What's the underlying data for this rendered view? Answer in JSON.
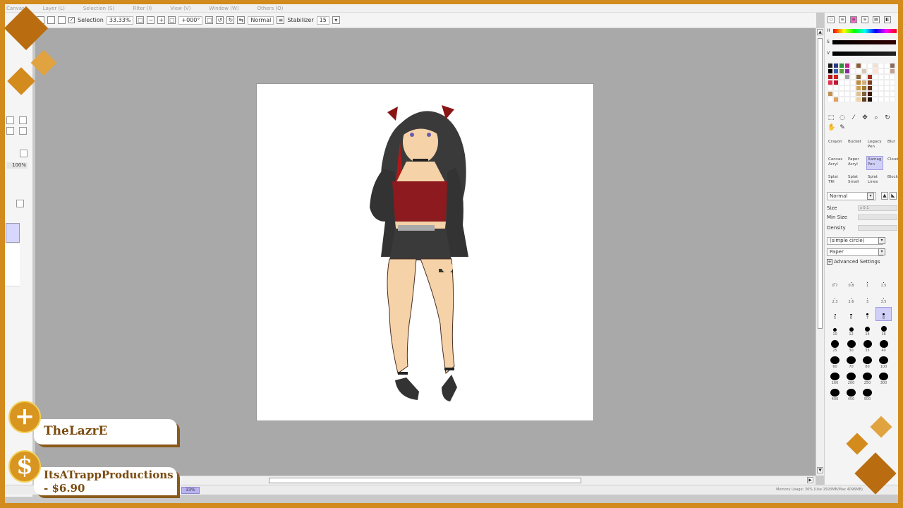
{
  "menu": {
    "items": [
      "Canvas",
      "Layer (L)",
      "Selection (S)",
      "Filter (I)",
      "View (V)",
      "Window (W)",
      "Others (O)"
    ]
  },
  "toolbar": {
    "selection_label": "Selection",
    "zoom_value": "33.33%",
    "rotation_value": "+000°",
    "blend_mode": "Normal",
    "stabilizer_label": "Stabilizer",
    "stabilizer_value": "15"
  },
  "left_panel": {
    "zoom_label": "100%"
  },
  "status": {
    "zoom_badge": "33%",
    "memory_text": "Memory Usage: 36% (Use 1593MB/Max 4096MB)"
  },
  "color_panel": {
    "h_label": "H",
    "s_label": "S",
    "v_label": "V",
    "swatch_colors": [
      "#1a1a1a",
      "#2a3a8a",
      "#2e8f3a",
      "#c0208a",
      "#ffffff",
      "#8a5a3a",
      "#ffffff",
      "#ffffff",
      "#f0e0d0",
      "#ffffff",
      "#ffffff",
      "#8a6a5a",
      "#000000",
      "#3a5aaa",
      "#5aa040",
      "#8a2aa0",
      "#ffffff",
      "#ffffff",
      "#d8c8b8",
      "#ffffff",
      "#ffe0d0",
      "#ffffff",
      "#ffffff",
      "#c0a090",
      "#b01818",
      "#d02020",
      "#ffffff",
      "#a0a0a0",
      "#ffffff",
      "#8a6a3a",
      "#ffffff",
      "#a03020",
      "#ffffff",
      "#ffffff",
      "#ffffff",
      "#ffffff",
      "#e03050",
      "#c01830",
      "#ffffff",
      "#ffffff",
      "#ffffff",
      "#c08a3a",
      "#d0b080",
      "#804020",
      "#ffffff",
      "#ffffff",
      "#ffffff",
      "#ffffff",
      "#ffffff",
      "#ffffff",
      "#ffffff",
      "#ffffff",
      "#ffffff",
      "#d0a050",
      "#a07830",
      "#603018",
      "#ffffff",
      "#ffffff",
      "#ffffff",
      "#ffffff",
      "#c09050",
      "#ffffff",
      "#ffffff",
      "#ffffff",
      "#ffffff",
      "#e0c090",
      "#806040",
      "#401808",
      "#ffffff",
      "#ffffff",
      "#ffffff",
      "#ffffff",
      "#ffffff",
      "#e0a060",
      "#ffffff",
      "#ffffff",
      "#ffffff",
      "#f0d0a0",
      "#604020",
      "#201008",
      "#ffffff",
      "#ffffff",
      "#ffffff",
      "#ffffff"
    ]
  },
  "tools": {
    "icons": [
      "rect-select-icon",
      "lasso-icon",
      "magic-wand-icon",
      "move-icon",
      "zoom-icon",
      "rotate-icon",
      "hand-icon",
      "eyedropper-icon"
    ],
    "glyphs": [
      "⬚",
      "◌",
      "⁄",
      "✥",
      "⌕",
      "↻",
      "✋",
      "✎"
    ]
  },
  "brushes": [
    {
      "name": "Crayon",
      "selected": false
    },
    {
      "name": "Bucket",
      "selected": false
    },
    {
      "name": "Legacy Pen",
      "selected": false
    },
    {
      "name": "Blur",
      "selected": false
    },
    {
      "name": "Canvas Acryl",
      "selected": false
    },
    {
      "name": "Paper Acryl",
      "selected": false
    },
    {
      "name": "Xamag Pen",
      "selected": true
    },
    {
      "name": "Cloud",
      "selected": false
    },
    {
      "name": "Splat TRI",
      "selected": false
    },
    {
      "name": "Splat Small",
      "selected": false
    },
    {
      "name": "Splat Lines",
      "selected": false
    },
    {
      "name": "Block",
      "selected": false
    }
  ],
  "brush_settings": {
    "blend": "Normal",
    "size_label": "Size",
    "size_value": "x 0.1",
    "min_size_label": "Min Size",
    "density_label": "Density",
    "shape": "(simple circle)",
    "texture": "Paper",
    "advanced_label": "Advanced Settings"
  },
  "brush_sizes": [
    {
      "label": "0.7",
      "dot": 0.5,
      "selected": false
    },
    {
      "label": "0.8",
      "dot": 0.6,
      "selected": false
    },
    {
      "label": "1",
      "dot": 0.7,
      "selected": false
    },
    {
      "label": "1.5",
      "dot": 0.8,
      "selected": false
    },
    {
      "label": "2.3",
      "dot": 0.9,
      "selected": false
    },
    {
      "label": "2.6",
      "dot": 1,
      "selected": false
    },
    {
      "label": "3",
      "dot": 1.1,
      "selected": false
    },
    {
      "label": "3.5",
      "dot": 1.2,
      "selected": false
    },
    {
      "label": "5",
      "dot": 2,
      "selected": false
    },
    {
      "label": "6",
      "dot": 2.3,
      "selected": false
    },
    {
      "label": "7",
      "dot": 2.7,
      "selected": false
    },
    {
      "label": "8",
      "dot": 3,
      "selected": true
    },
    {
      "label": "10",
      "dot": 5,
      "selected": false
    },
    {
      "label": "12",
      "dot": 6,
      "selected": false
    },
    {
      "label": "14",
      "dot": 7,
      "selected": false
    },
    {
      "label": "16",
      "dot": 8,
      "selected": false
    },
    {
      "label": "25",
      "dot": 11,
      "selected": false
    },
    {
      "label": "30",
      "dot": 12,
      "selected": false
    },
    {
      "label": "35",
      "dot": 12,
      "selected": false
    },
    {
      "label": "40",
      "dot": 12,
      "selected": false
    },
    {
      "label": "60",
      "dot": 13,
      "selected": false
    },
    {
      "label": "70",
      "dot": 13,
      "selected": false
    },
    {
      "label": "80",
      "dot": 13,
      "selected": false
    },
    {
      "label": "100",
      "dot": 13,
      "selected": false
    },
    {
      "label": "160",
      "dot": 13,
      "selected": false
    },
    {
      "label": "200",
      "dot": 13,
      "selected": false
    },
    {
      "label": "250",
      "dot": 13,
      "selected": false
    },
    {
      "label": "300",
      "dot": 13,
      "selected": false
    },
    {
      "label": "400",
      "dot": 13,
      "selected": false
    },
    {
      "label": "450",
      "dot": 13,
      "selected": false
    },
    {
      "label": "500",
      "dot": 13,
      "selected": false
    }
  ],
  "overlay": {
    "follower_name": "TheLazrE",
    "donor_name": "ItsATrappProductions",
    "donation_amount": "- $6.90",
    "follower_icon": "plus-icon",
    "donation_icon": "dollar-icon",
    "follower_glyph": "+",
    "donation_glyph": "$"
  },
  "colors": {
    "accent_orange": "#d38b1d",
    "diamond_dark": "#b96d10",
    "diamond_light": "#e1a340",
    "selection_purple": "#d0cff8"
  }
}
